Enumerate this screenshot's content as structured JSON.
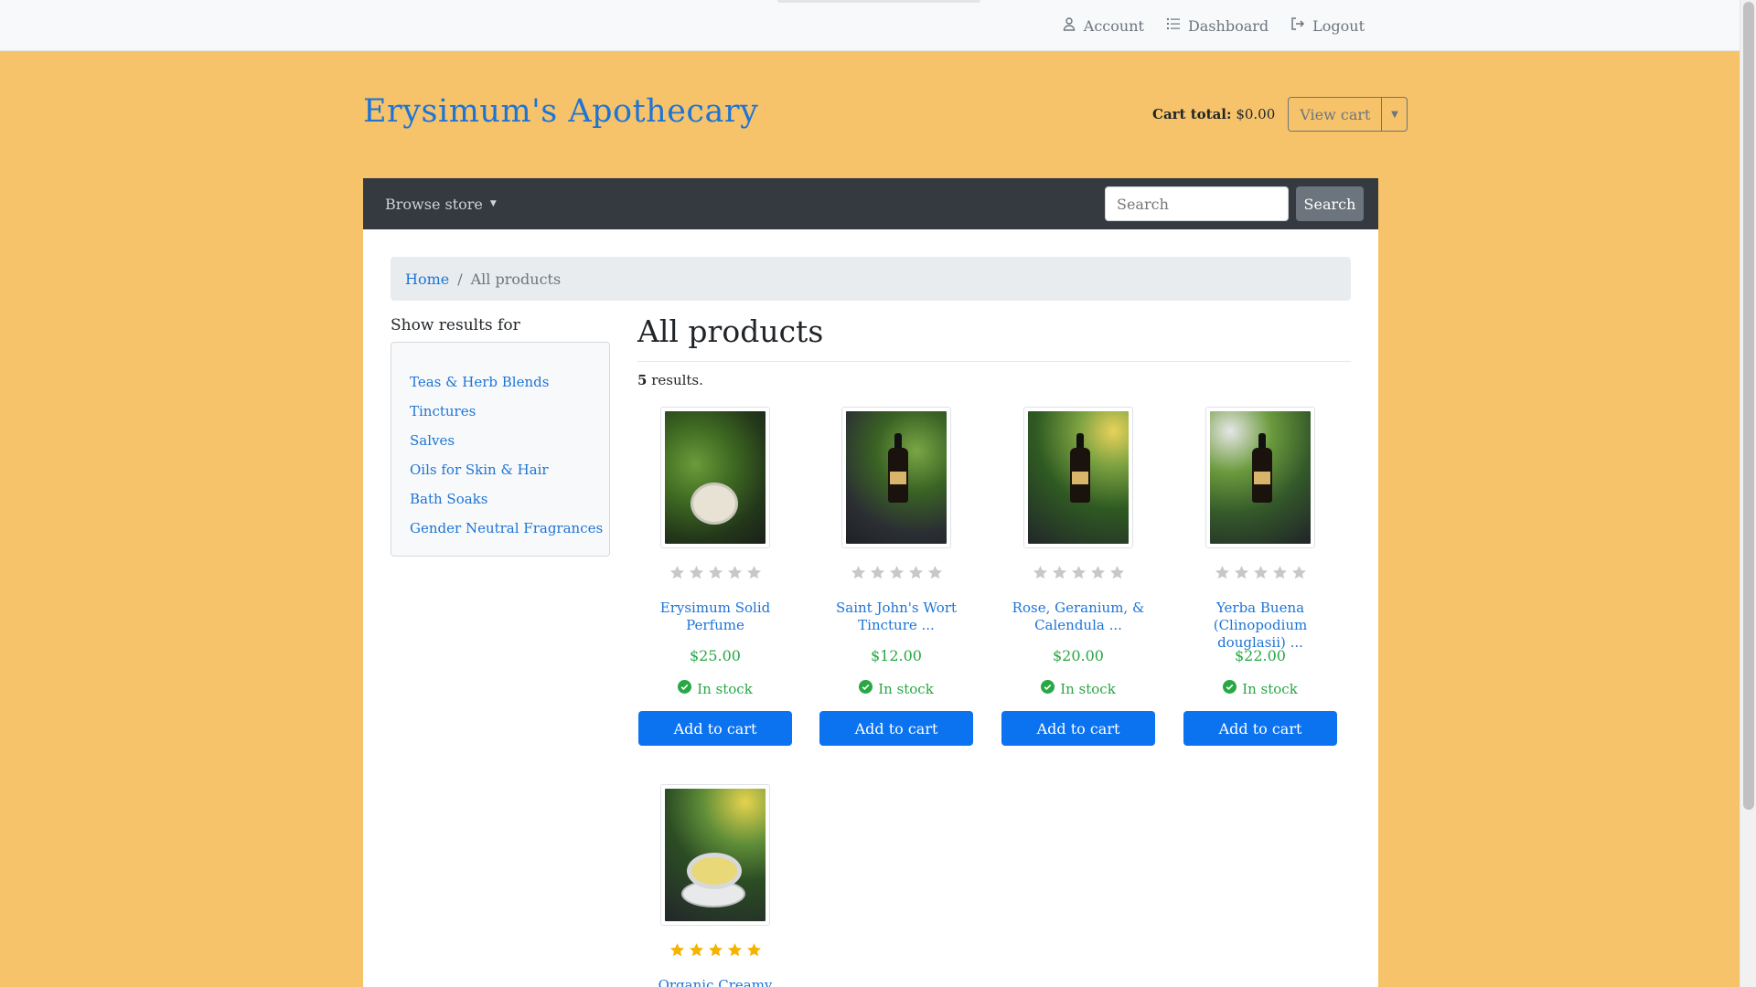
{
  "topbar": {
    "account_label": "Account",
    "dashboard_label": "Dashboard",
    "logout_label": "Logout"
  },
  "brand": "Erysimum's Apothecary",
  "cart": {
    "total_label": "Cart total:",
    "total_value": "$0.00",
    "view_cart_label": "View cart"
  },
  "navbar": {
    "browse_label": "Browse store",
    "search_placeholder": "Search",
    "search_button": "Search"
  },
  "breadcrumb": {
    "home": "Home",
    "separator": "/",
    "current": "All products"
  },
  "sidebar": {
    "title": "Show results for",
    "categories": [
      "Teas & Herb Blends",
      "Tinctures",
      "Salves",
      "Oils for Skin & Hair",
      "Bath Soaks",
      "Gender Neutral Fragrances"
    ]
  },
  "main": {
    "title": "All products",
    "results_count": "5",
    "results_suffix": " results."
  },
  "products": [
    {
      "name": "Erysimum Solid Perfume",
      "price": "$25.00",
      "stock": "In stock",
      "button": "Add to cart",
      "rating": 0
    },
    {
      "name": "Saint John's Wort Tincture ...",
      "price": "$12.00",
      "stock": "In stock",
      "button": "Add to cart",
      "rating": 0
    },
    {
      "name": "Rose, Geranium, & Calendula ...",
      "price": "$20.00",
      "stock": "In stock",
      "button": "Add to cart",
      "rating": 0
    },
    {
      "name": "Yerba Buena (Clinopodium douglasii) ...",
      "price": "$22.00",
      "stock": "In stock",
      "button": "Add to cart",
      "rating": 0
    },
    {
      "name": "Organic Creamy",
      "rating": 5
    }
  ],
  "colors": {
    "page_background": "#f7c36a",
    "link": "#1d74d6",
    "navbar": "#343a40",
    "primary_button": "#0b72f0",
    "in_stock": "#28a745",
    "star_filled": "#f5b301",
    "star_empty": "#c8c8c8"
  },
  "icons": {
    "account": "user-icon",
    "dashboard": "list-icon",
    "logout": "sign-out-icon",
    "stock": "check-circle-icon",
    "rating": "star-icon"
  }
}
